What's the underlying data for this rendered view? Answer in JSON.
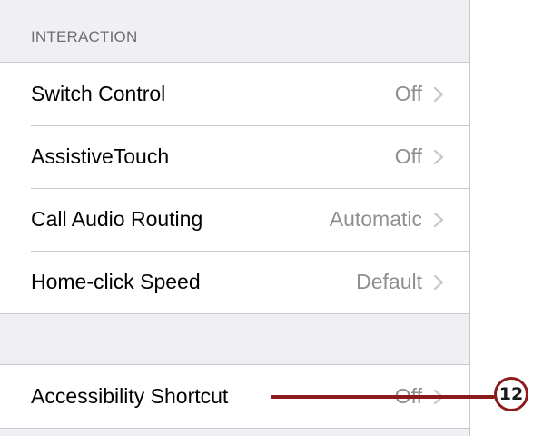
{
  "section": {
    "header": "INTERACTION"
  },
  "interaction_rows": [
    {
      "label": "Switch Control",
      "value": "Off"
    },
    {
      "label": "AssistiveTouch",
      "value": "Off"
    },
    {
      "label": "Call Audio Routing",
      "value": "Automatic"
    },
    {
      "label": "Home-click Speed",
      "value": "Default"
    }
  ],
  "shortcut_row": {
    "label": "Accessibility Shortcut",
    "value": "Off"
  },
  "callout": {
    "number": "12",
    "color": "#8b1a1a"
  },
  "icons": {
    "chevron": "chevron-right-icon"
  },
  "colors": {
    "background": "#efeff4",
    "cell": "#ffffff",
    "value_text": "#8e8e93",
    "header_text": "#6d6d72"
  }
}
